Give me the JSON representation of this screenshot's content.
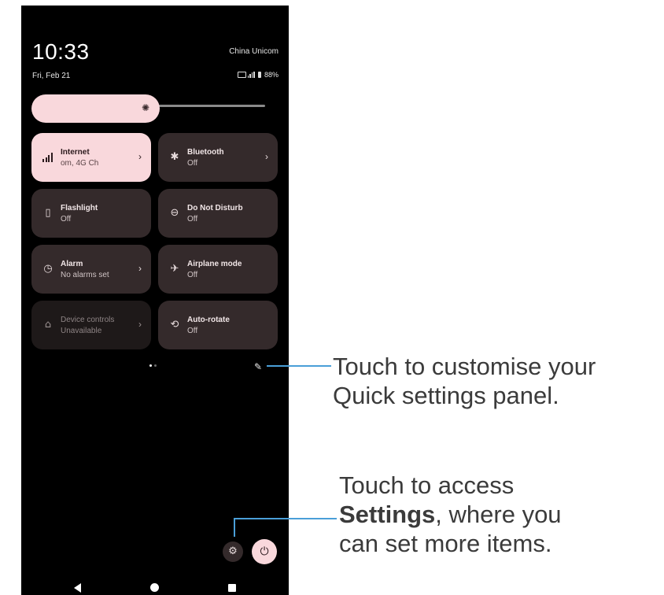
{
  "status_bar": {
    "time": "10:33",
    "date": "Fri, Feb 21",
    "carrier": "China Unicom",
    "battery": "88%"
  },
  "brightness": {
    "level": 0.48,
    "icon": "brightness-icon"
  },
  "tiles": [
    {
      "name": "Internet",
      "sub": "om, 4G      Ch",
      "icon": "cellular-signal-icon",
      "state": "on",
      "chevron": true
    },
    {
      "name": "Bluetooth",
      "sub": "Off",
      "icon": "bluetooth-icon",
      "state": "off",
      "chevron": true
    },
    {
      "name": "Flashlight",
      "sub": "Off",
      "icon": "flashlight-icon",
      "state": "off",
      "chevron": false
    },
    {
      "name": "Do Not Disturb",
      "sub": "Off",
      "icon": "do-not-disturb-icon",
      "state": "off",
      "chevron": false
    },
    {
      "name": "Alarm",
      "sub": "No alarms set",
      "icon": "alarm-icon",
      "state": "off",
      "chevron": true
    },
    {
      "name": "Airplane mode",
      "sub": "Off",
      "icon": "airplane-icon",
      "state": "off",
      "chevron": false
    },
    {
      "name": "Device controls",
      "sub": "Unavailable",
      "icon": "home-icon",
      "state": "unavailable",
      "chevron": true
    },
    {
      "name": "Auto-rotate",
      "sub": "Off",
      "icon": "auto-rotate-icon",
      "state": "off",
      "chevron": false
    }
  ],
  "glyphs": {
    "chevron": "›",
    "brightness": "✺",
    "bluetooth": "✱",
    "flashlight": "▯",
    "dnd": "⊖",
    "alarm": "◷",
    "airplane": "✈",
    "home": "⌂",
    "rotate": "⟲",
    "pencil": "✎",
    "gear": "⚙",
    "power": "⏻"
  },
  "pages": {
    "current": 1,
    "total": 2
  },
  "callouts": {
    "edit_line1": "Touch to customise your",
    "edit_line2": "Quick settings panel.",
    "settings_line1": "Touch to access",
    "settings_bold": "Settings",
    "settings_rest": ", where you",
    "settings_line3": "can set more items."
  },
  "colors": {
    "tile_on": "#f9d8dc",
    "tile_off": "#342a2b",
    "callout_line": "#4a9fd8",
    "callout_text": "#3b3b3b"
  }
}
